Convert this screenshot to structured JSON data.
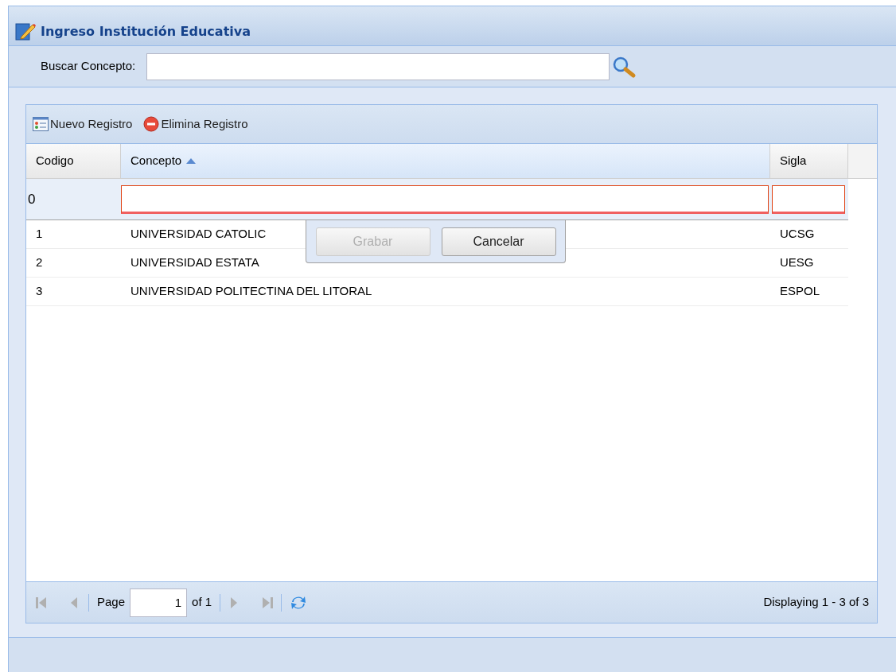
{
  "window": {
    "title": "Ingreso Institución Educativa"
  },
  "search": {
    "label": "Buscar Concepto:"
  },
  "toolbar": [
    {
      "kind": "new",
      "label": "Nuevo Registro"
    },
    {
      "kind": "delete",
      "label": "Elimina Registro"
    }
  ],
  "table": {
    "columns": [
      {
        "label": "Codigo",
        "sorted": false
      },
      {
        "label": "Concepto",
        "sorted": true
      },
      {
        "label": "Sigla",
        "sorted": false
      }
    ],
    "editor": {
      "codigo": "0",
      "invalid": true
    },
    "rows": [
      [
        "1",
        "UNIVERSIDAD CATOLIC",
        "UCSG"
      ],
      [
        "2",
        "UNIVERSIDAD ESTATA",
        "UESG"
      ],
      [
        "3",
        "UNIVERSIDAD POLITECTINA DEL LITORAL",
        "ESPOL"
      ]
    ],
    "row_buttons": [
      {
        "label": "Grabar",
        "disabled": true
      },
      {
        "label": "Cancelar",
        "disabled": false
      }
    ]
  },
  "paging": {
    "page_label": "Page",
    "page": "1",
    "of": "of 1",
    "display": "Displaying 1 - 3 of 3"
  }
}
